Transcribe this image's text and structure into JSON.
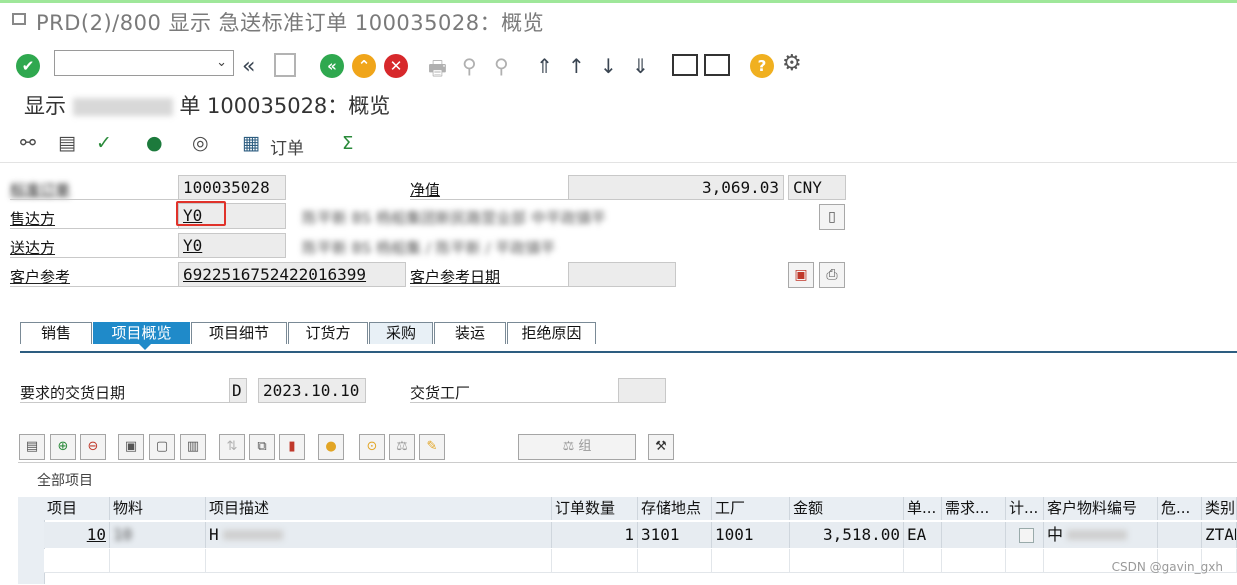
{
  "window": {
    "title": "PRD(2)/800 显示 急送标准订单 100035028：概览"
  },
  "toolbar1": {
    "command_value": "",
    "icons": [
      "enter-icon",
      "back-icon",
      "save-icon",
      "back-green-icon",
      "exit-icon",
      "cancel-icon",
      "print-icon",
      "find-icon",
      "find-next-icon",
      "first-page-icon",
      "prev-page-icon",
      "next-page-icon",
      "last-page-icon",
      "new-session-icon",
      "shortcut-icon",
      "help-icon",
      "settings-icon"
    ]
  },
  "page": {
    "title_prefix": "显示",
    "title_suffix": "单 100035028：概览"
  },
  "toolbar2": {
    "order_label": "订单",
    "sum_symbol": "Σ"
  },
  "header": {
    "order_label": "标准订单",
    "order_value": "100035028",
    "net_label": "净值",
    "net_value": "3,069.03",
    "currency": "CNY",
    "sold_to_label": "售达方",
    "sold_to_value": "Y0",
    "sold_to_desc": "陈平新 BS 杨船集团新民路营业部 中平政镇平",
    "ship_to_label": "送达方",
    "ship_to_value": "Y0",
    "ship_to_desc": "陈平新 BS 杨船集 / 陈平新 / 平政镇平",
    "cust_ref_label": "客户参考",
    "cust_ref_value": "6922516752422016399",
    "cust_ref_date_label": "客户参考日期",
    "cust_ref_date_value": ""
  },
  "tabs": [
    {
      "label": "销售"
    },
    {
      "label": "项目概览"
    },
    {
      "label": "项目细节"
    },
    {
      "label": "订货方"
    },
    {
      "label": "采购"
    },
    {
      "label": "装运"
    },
    {
      "label": "拒绝原因"
    }
  ],
  "delivery": {
    "req_date_label": "要求的交货日期",
    "date_type": "D",
    "req_date_value": "2023.10.10",
    "plant_label": "交货工厂",
    "plant_value": ""
  },
  "table_toolbar": {
    "group_label": "组"
  },
  "grid": {
    "section_label": "全部项目",
    "columns": [
      "项目",
      "物料",
      "项目描述",
      "订单数量",
      "存储地点",
      "工厂",
      "金额",
      "单...",
      "需求...",
      "计...",
      "客户物料编号",
      "危...",
      "类别"
    ],
    "row": {
      "item": "10",
      "material": "10",
      "description": "H",
      "qty": "1",
      "storage_loc": "3101",
      "plant": "1001",
      "amount": "3,518.00",
      "unit": "EA",
      "req": "",
      "calc": "",
      "cust_mat": "中",
      "danger": "",
      "category": "ZTAN"
    }
  },
  "watermark": "CSDN @gavin_gxh"
}
